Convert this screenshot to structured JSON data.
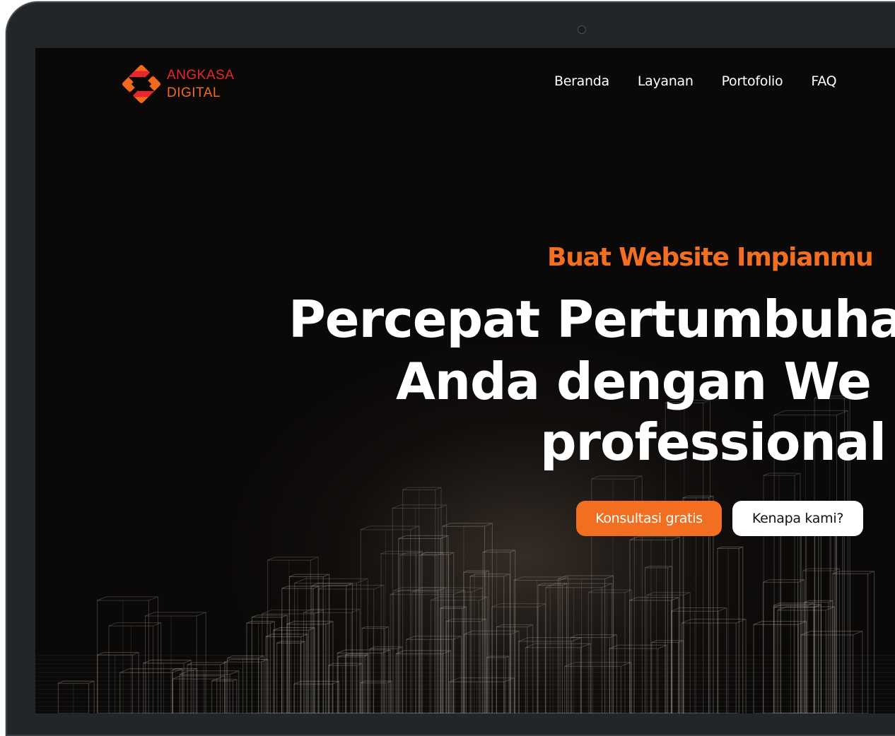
{
  "brand": {
    "line1": "ANGKASA",
    "line2": "DIGITAL",
    "red": "#e8262b",
    "orange": "#f26a1d",
    "logo_icon": "angkasa-logo-icon"
  },
  "nav": {
    "items": [
      {
        "label": "Beranda"
      },
      {
        "label": "Layanan"
      },
      {
        "label": "Portofolio"
      },
      {
        "label": "FAQ"
      }
    ]
  },
  "hero": {
    "eyebrow": "Buat Website Impianmu",
    "title_lines": [
      "Percepat Pertumbuha",
      "Anda dengan We",
      "professional"
    ],
    "primary_cta": "Konsultasi gratis",
    "secondary_cta": "Kenapa kami?",
    "accent": "#f26f21",
    "background_image": "wireframe-city-skyline"
  }
}
